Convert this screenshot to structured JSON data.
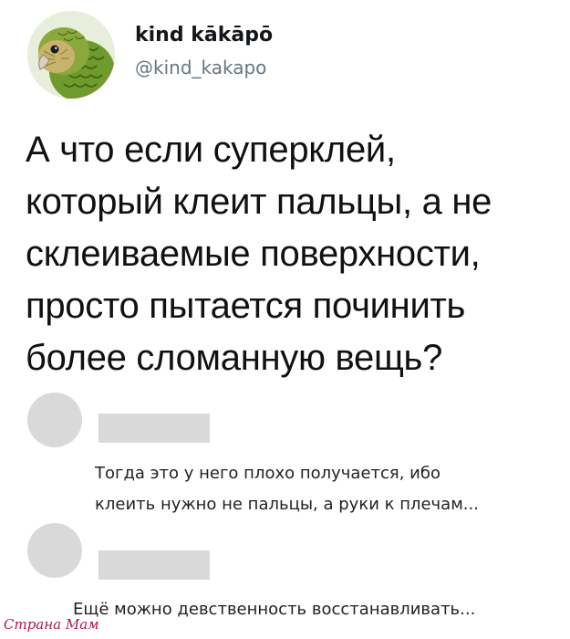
{
  "tweet": {
    "display_name": "kind kākāpō",
    "handle": "@kind_kakapo",
    "avatar_icon": "kakapo-parrot-avatar",
    "text_lines": [
      "А что если суперклей,",
      "который клеит пальцы, а не",
      "склеиваемые поверхности,",
      "просто пытается починить",
      "более сломанную вещь?"
    ]
  },
  "replies": [
    {
      "text_lines": [
        "Тогда это у него плохо получается, ибо",
        "клеить нужно не пальцы, а руки к плечам..."
      ]
    },
    {
      "text_lines": [
        "Ещё можно девственность восстанавливать..."
      ]
    }
  ],
  "watermark": "Страна Мам",
  "colors": {
    "text": "#111111",
    "handle": "#657786",
    "placeholder": "#d9d9d9",
    "watermark": "#b0174f"
  }
}
